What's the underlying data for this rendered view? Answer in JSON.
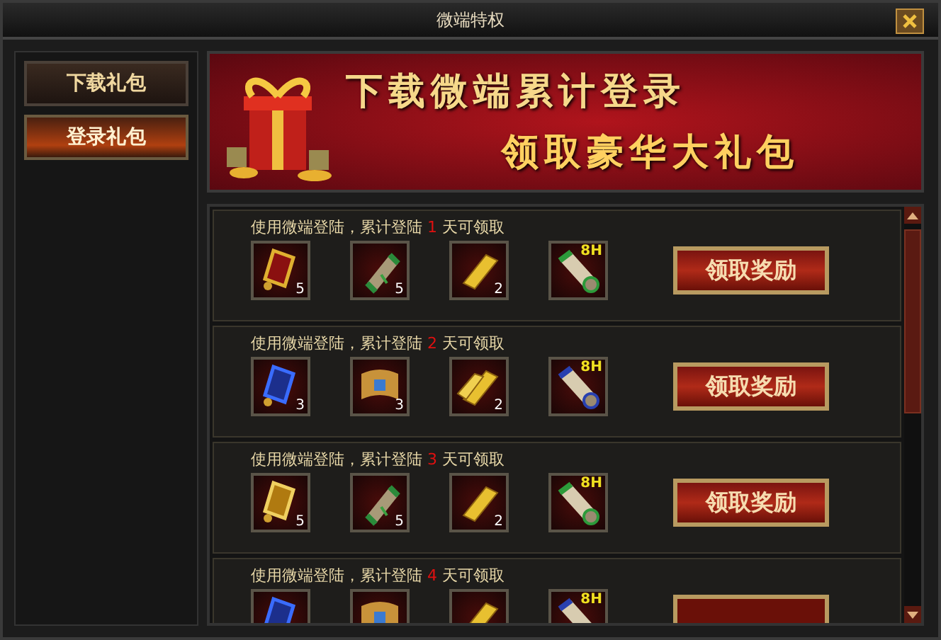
{
  "window": {
    "title": "微端特权"
  },
  "tabs": [
    {
      "label": "下载礼包",
      "selected": false
    },
    {
      "label": "登录礼包",
      "selected": true
    }
  ],
  "banner": {
    "line_1": "下载微端累计登录",
    "line_2": "领取豪华大礼包"
  },
  "rewards": [
    {
      "text_before": "使用微端登陆，累计登陆",
      "day": "1",
      "text_after": "天可领取",
      "button": "领取奖励",
      "items": [
        {
          "kind": "token",
          "count": "5"
        },
        {
          "kind": "scroll",
          "count": "5"
        },
        {
          "kind": "goldbar",
          "count": "2"
        },
        {
          "kind": "timescroll",
          "badge": "8H"
        }
      ]
    },
    {
      "text_before": "使用微端登陆，累计登陆",
      "day": "2",
      "text_after": "天可领取",
      "button": "领取奖励",
      "items": [
        {
          "kind": "bluetoken",
          "count": "3"
        },
        {
          "kind": "map",
          "count": "3"
        },
        {
          "kind": "goldbars",
          "count": "2"
        },
        {
          "kind": "bluetimescroll",
          "badge": "8H"
        }
      ]
    },
    {
      "text_before": "使用微端登陆，累计登陆",
      "day": "3",
      "text_after": "天可领取",
      "button": "领取奖励",
      "items": [
        {
          "kind": "goldtoken",
          "count": "5"
        },
        {
          "kind": "scroll",
          "count": "5"
        },
        {
          "kind": "goldbar",
          "count": "2"
        },
        {
          "kind": "timescroll",
          "badge": "8H"
        }
      ]
    },
    {
      "text_before": "使用微端登陆，累计登陆",
      "day": "4",
      "text_after": "天可领取",
      "items": [
        {
          "kind": "bluetoken"
        },
        {
          "kind": "map"
        },
        {
          "kind": "goldbar"
        },
        {
          "kind": "bluetimescroll",
          "badge": "8H"
        }
      ]
    }
  ]
}
